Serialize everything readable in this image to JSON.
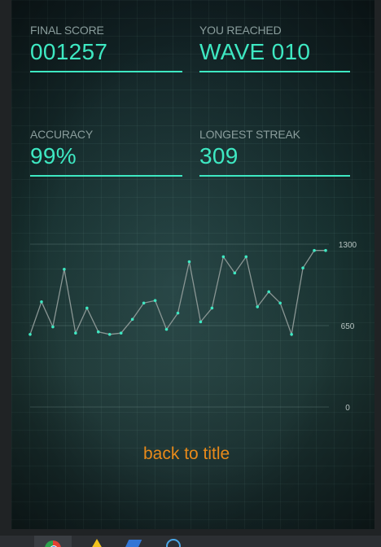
{
  "stats": {
    "final_score": {
      "label": "FINAL SCORE",
      "value": "001257"
    },
    "wave": {
      "label": "YOU REACHED",
      "value": "WAVE 010"
    },
    "accuracy": {
      "label": "ACCURACY",
      "value": "99%"
    },
    "streak": {
      "label": "LONGEST STREAK",
      "value": "309"
    }
  },
  "chart_data": {
    "type": "line",
    "title": "",
    "xlabel": "",
    "ylabel": "",
    "ylim": [
      0,
      1300
    ],
    "y_ticks": [
      "1300",
      "650",
      "0"
    ],
    "grid": true,
    "series": [
      {
        "values": [
          580,
          840,
          640,
          1100,
          590,
          790,
          600,
          580,
          590,
          700,
          830,
          850,
          620,
          750,
          1160,
          680,
          790,
          1200,
          1070,
          1200,
          800,
          920,
          830,
          580,
          1110,
          1250,
          1250
        ]
      }
    ]
  },
  "back_button": {
    "label": "back to title"
  },
  "colors": {
    "accent": "#3ee8c2",
    "label": "#8a9d9c",
    "button": "#e88a1a",
    "chart_line": "#8a9694",
    "chart_point": "#3ee8c2"
  },
  "taskbar": {
    "icons": [
      "chrome-icon",
      "warning-icon",
      "blue-app-icon",
      "circle-app-icon"
    ]
  }
}
